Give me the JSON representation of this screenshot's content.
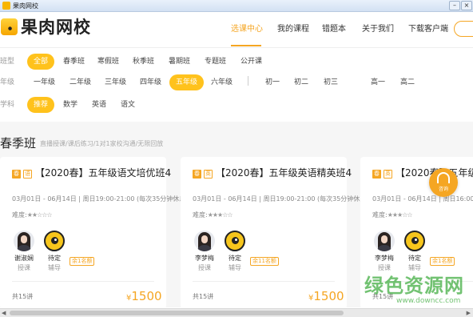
{
  "window": {
    "title": "果肉网校"
  },
  "header": {
    "logo_text": "果肉网校",
    "nav": [
      "选课中心",
      "我的课程",
      "错题本",
      "关于我们",
      "下载客户端"
    ],
    "active_nav": "选课中心"
  },
  "filters": {
    "class_type": {
      "label": "班型",
      "options": [
        "全部",
        "春季班",
        "寒假班",
        "秋季班",
        "暑期班",
        "专题班",
        "公开课"
      ],
      "selected": "全部"
    },
    "grade": {
      "label": "年级",
      "options": [
        "一年级",
        "二年级",
        "三年级",
        "四年级",
        "五年级",
        "六年级",
        "初一",
        "初二",
        "初三",
        "高一",
        "高二"
      ],
      "selected": "五年级"
    },
    "subject": {
      "label": "学科",
      "options": [
        "推荐",
        "数学",
        "英语",
        "语文"
      ],
      "selected": "推荐"
    }
  },
  "section": {
    "title": "春季班",
    "subtitle": "直播授课/课后练习/1对1家校沟通/无限回放"
  },
  "cards": [
    {
      "tag_season": "春",
      "tag_subject": "语",
      "title": "【2020春】五年级语文培优班4",
      "time": "03月01日 - 06月14日 | 周日19:00-21:00 (每次35分钟休息一",
      "difficulty_label": "难度:",
      "difficulty_stars": "★★☆☆☆",
      "teacher": {
        "name": "谢淑娴",
        "role": "授课"
      },
      "tutor": {
        "name": "待定",
        "role": "辅导"
      },
      "seats": "余1名额",
      "lessons": "共15讲",
      "price": "1500",
      "currency": "¥"
    },
    {
      "tag_season": "春",
      "tag_subject": "英",
      "title": "【2020春】五年级英语精英班4",
      "time": "03月01日 - 06月14日 | 周日19:00-21:00 (每次35分钟休息一",
      "difficulty_label": "难度:",
      "difficulty_stars": "★★★☆☆",
      "teacher": {
        "name": "李梦梅",
        "role": "授课"
      },
      "tutor": {
        "name": "待定",
        "role": "辅导"
      },
      "seats": "余11名额",
      "lessons": "共15讲",
      "price": "1500",
      "currency": "¥"
    },
    {
      "tag_season": "春",
      "tag_subject": "英",
      "title": "【2020春】五年级英",
      "time": "03月01日 - 06月14日 | 周日16:00",
      "difficulty_label": "难度:",
      "difficulty_stars": "★★★☆☆",
      "teacher": {
        "name": "李梦梅",
        "role": "授课"
      },
      "tutor": {
        "name": "待定",
        "role": "辅导"
      },
      "seats": "余1名额",
      "lessons": "共15讲",
      "price": "",
      "currency": ""
    }
  ],
  "float_button": {
    "label": "咨询"
  },
  "watermark": {
    "title": "绿色资源网",
    "url": "www.downcc.com"
  },
  "colors": {
    "accent": "#f5a623",
    "pill": "#ffc21c",
    "watermark": "#3caa3c"
  }
}
